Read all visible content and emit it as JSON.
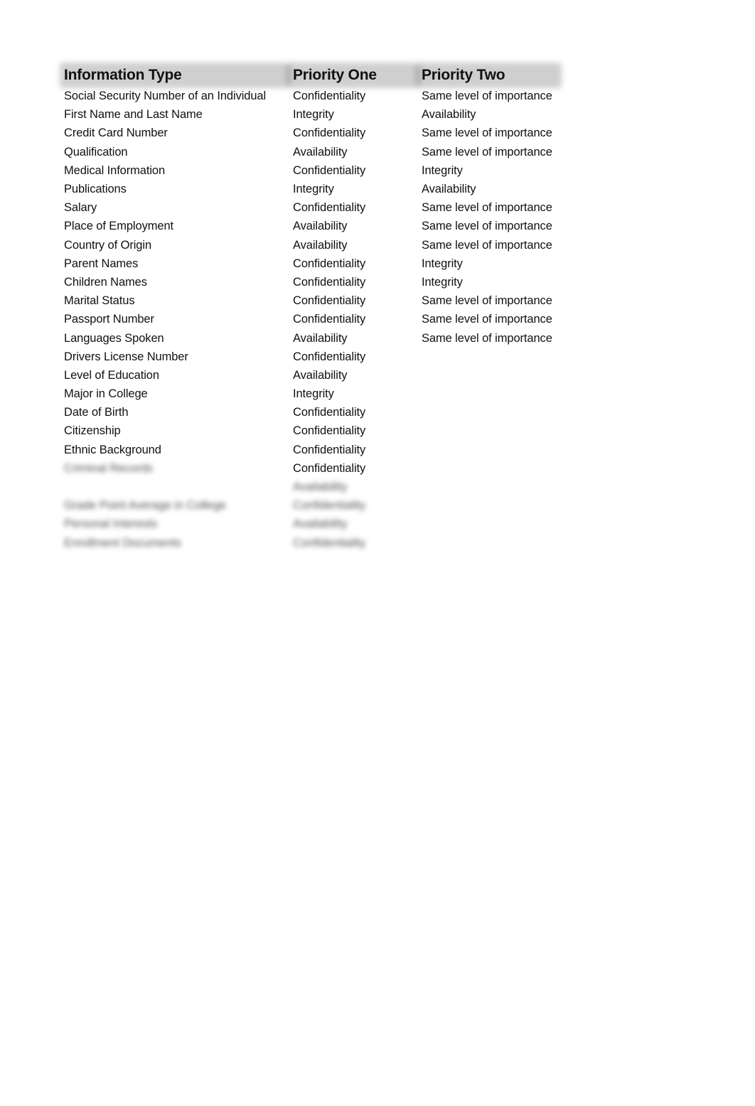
{
  "table": {
    "headers": {
      "information_type": "Information Type",
      "priority_one": "Priority One",
      "priority_two": "Priority Two"
    },
    "rows": [
      {
        "type": "Social Security Number of an Individual",
        "p1": "Confidentiality",
        "p2": "Same level of importance"
      },
      {
        "type": "First Name and Last Name",
        "p1": "Integrity",
        "p2": "Availability"
      },
      {
        "type": "Credit Card Number",
        "p1": "Confidentiality",
        "p2": "Same level of importance"
      },
      {
        "type": "Qualification",
        "p1": "Availability",
        "p2": "Same level of importance"
      },
      {
        "type": "Medical Information",
        "p1": "Confidentiality",
        "p2": "Integrity"
      },
      {
        "type": "Publications",
        "p1": "Integrity",
        "p2": "Availability"
      },
      {
        "type": "Salary",
        "p1": "Confidentiality",
        "p2": "Same level of importance"
      },
      {
        "type": "Place of Employment",
        "p1": "Availability",
        "p2": "Same level of importance"
      },
      {
        "type": "Country of Origin",
        "p1": "Availability",
        "p2": "Same level of importance"
      },
      {
        "type": "Parent Names",
        "p1": "Confidentiality",
        "p2": "Integrity"
      },
      {
        "type": "Children Names",
        "p1": "Confidentiality",
        "p2": "Integrity"
      },
      {
        "type": "Marital Status",
        "p1": "Confidentiality",
        "p2": "Same level of importance"
      },
      {
        "type": "Passport Number",
        "p1": "Confidentiality",
        "p2": "Same level of importance"
      },
      {
        "type": "Languages Spoken",
        "p1": "Availability",
        "p2": "Same level of importance"
      },
      {
        "type": "Drivers License Number",
        "p1": "Confidentiality",
        "p2": ""
      },
      {
        "type": "Level of Education",
        "p1": "Availability",
        "p2": ""
      },
      {
        "type": "Major in College",
        "p1": "Integrity",
        "p2": ""
      },
      {
        "type": "Date of Birth",
        "p1": "Confidentiality",
        "p2": ""
      },
      {
        "type": "Citizenship",
        "p1": "Confidentiality",
        "p2": ""
      },
      {
        "type": "Ethnic Background",
        "p1": "Confidentiality",
        "p2": ""
      }
    ],
    "blurred_rows": [
      {
        "type": "Criminal Records",
        "p1": "Confidentiality",
        "p1_blurred": false
      },
      {
        "type": "",
        "p1": "Availability",
        "p1_blurred": true
      },
      {
        "type": "Grade Point Average in College",
        "p1": "Confidentiality",
        "p1_blurred": true
      },
      {
        "type": "Personal Interests",
        "p1": "Availability",
        "p1_blurred": true
      },
      {
        "type": "Enrollment Documents",
        "p1": "Confidentiality",
        "p1_blurred": true
      }
    ]
  }
}
